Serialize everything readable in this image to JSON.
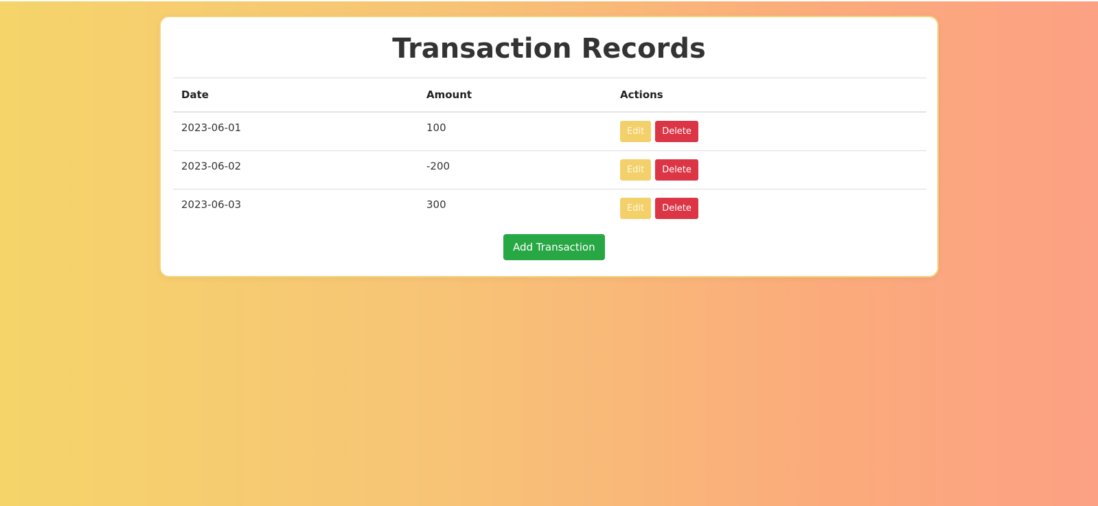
{
  "page": {
    "title": "Transaction Records"
  },
  "table": {
    "headers": {
      "date": "Date",
      "amount": "Amount",
      "actions": "Actions"
    },
    "rows": [
      {
        "date": "2023-06-01",
        "amount": "100",
        "edit_label": "Edit",
        "delete_label": "Delete"
      },
      {
        "date": "2023-06-02",
        "amount": "-200",
        "edit_label": "Edit",
        "delete_label": "Delete"
      },
      {
        "date": "2023-06-03",
        "amount": "300",
        "edit_label": "Edit",
        "delete_label": "Delete"
      }
    ]
  },
  "actions": {
    "add_label": "Add Transaction"
  },
  "colors": {
    "background_start": "#f5d46a",
    "background_end": "#fca184",
    "edit_button": "#f3d06a",
    "delete_button": "#dc3545",
    "add_button": "#28a745"
  }
}
